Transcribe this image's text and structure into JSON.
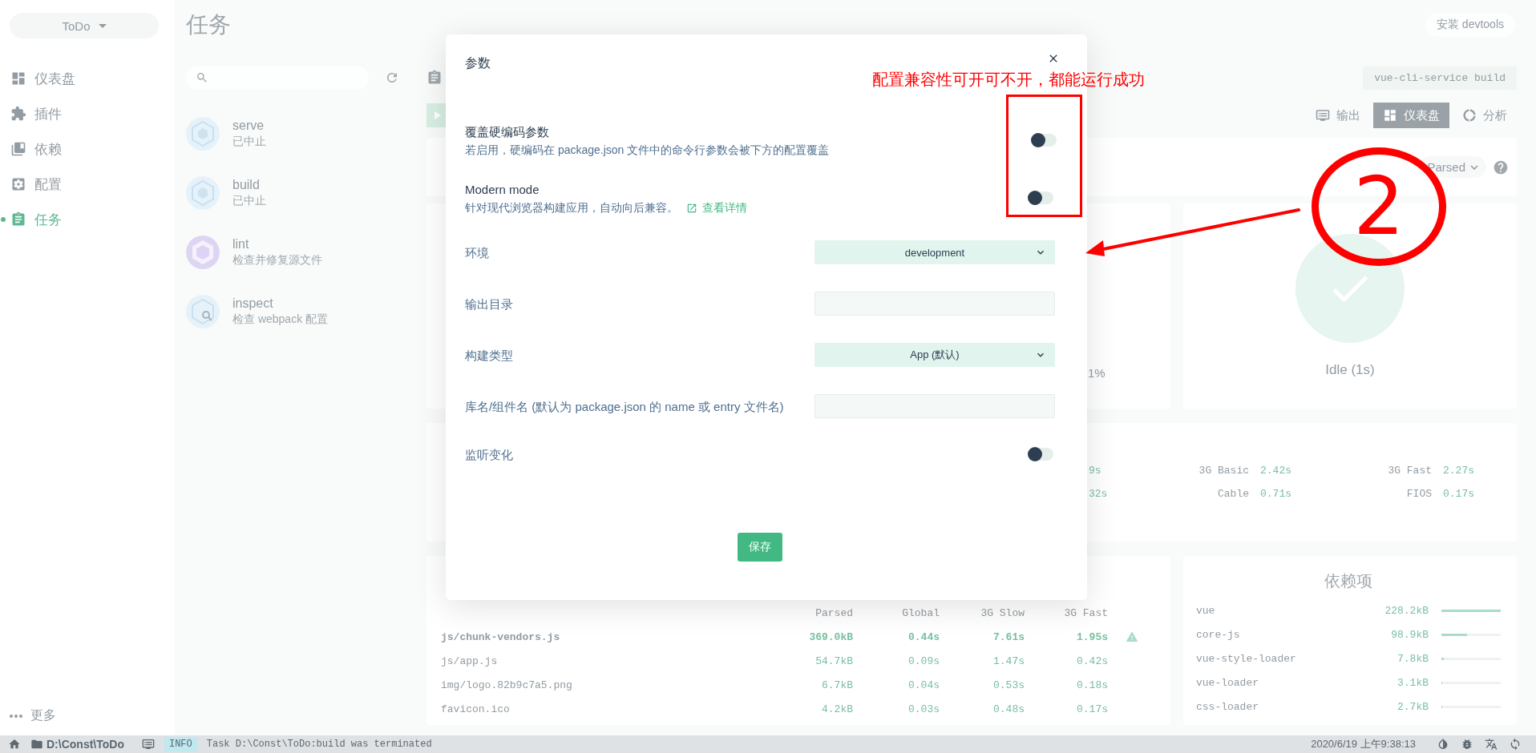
{
  "sidebar": {
    "project": "ToDo",
    "items": [
      {
        "label": "仪表盘",
        "selected": false
      },
      {
        "label": "插件",
        "selected": false
      },
      {
        "label": "依赖",
        "selected": false
      },
      {
        "label": "配置",
        "selected": false
      },
      {
        "label": "任务",
        "selected": true
      }
    ],
    "more": "更多"
  },
  "header": {
    "title": "任务",
    "devtools_button": "安装 devtools"
  },
  "tasks": [
    {
      "name": "serve",
      "status": "已中止",
      "kind": "webpack"
    },
    {
      "name": "build",
      "status": "已中止",
      "kind": "webpack"
    },
    {
      "name": "lint",
      "status": "检查并修复源文件",
      "kind": "eslint"
    },
    {
      "name": "inspect",
      "status": "检查 webpack 配置",
      "kind": "inspect"
    }
  ],
  "task_detail": {
    "command": "vue-cli-service build",
    "tabs": [
      {
        "label": "输出",
        "selected": false
      },
      {
        "label": "仪表盘",
        "selected": true
      },
      {
        "label": "分析",
        "selected": false
      }
    ],
    "size_select": "Parsed",
    "progress_reading": "1%",
    "status": "Idle (1s)",
    "speed": {
      "partial_values": [
        "9s",
        "32s"
      ],
      "groups": [
        {
          "rows": [
            {
              "label": "3G Basic",
              "value": "2.42s"
            },
            {
              "label": "Cable",
              "value": "0.71s"
            }
          ]
        },
        {
          "rows": [
            {
              "label": "3G Fast",
              "value": "2.27s"
            },
            {
              "label": "FIOS",
              "value": "0.17s"
            }
          ]
        }
      ]
    },
    "assets": {
      "columns": [
        "Parsed",
        "Global",
        "3G Slow",
        "3G Fast"
      ],
      "rows": [
        {
          "name": "js/chunk-vendors.js",
          "values": [
            "369.0kB",
            "0.44s",
            "7.61s",
            "1.95s"
          ],
          "warning": true
        },
        {
          "name": "js/app.js",
          "values": [
            "54.7kB",
            "0.09s",
            "1.47s",
            "0.42s"
          ],
          "warning": false
        },
        {
          "name": "img/logo.82b9c7a5.png",
          "values": [
            "6.7kB",
            "0.04s",
            "0.53s",
            "0.18s"
          ],
          "warning": false
        },
        {
          "name": "favicon.ico",
          "values": [
            "4.2kB",
            "0.03s",
            "0.48s",
            "0.17s"
          ],
          "warning": false
        }
      ]
    },
    "dependencies": {
      "title": "依赖项",
      "rows": [
        {
          "name": "vue",
          "size": "228.2kB",
          "level": 1
        },
        {
          "name": "core-js",
          "size": "98.9kB",
          "level": 0.43
        },
        {
          "name": "vue-style-loader",
          "size": "7.8kB",
          "level": 0.04
        },
        {
          "name": "vue-loader",
          "size": "3.1kB",
          "level": 0.015
        },
        {
          "name": "css-loader",
          "size": "2.7kB",
          "level": 0.013
        }
      ]
    }
  },
  "dialog": {
    "title": "参数",
    "fields": [
      {
        "kind": "toggle",
        "label": "覆盖硬编码参数",
        "description": "若启用，硬编码在 package.json 文件中的命令行参数会被下方的配置覆盖",
        "on": false
      },
      {
        "kind": "toggle",
        "label": "Modern mode",
        "description": "针对现代浏览器构建应用，自动向后兼容。",
        "link": "查看详情",
        "on": false
      },
      {
        "kind": "select",
        "label": "环境",
        "value": "development"
      },
      {
        "kind": "input",
        "label": "输出目录"
      },
      {
        "kind": "select",
        "label": "构建类型",
        "value": "App (默认)"
      },
      {
        "kind": "input",
        "label": "库名/组件名 (默认为 package.json 的 name 或 entry 文件名)"
      },
      {
        "kind": "toggle",
        "label": "监听变化",
        "on": false
      }
    ],
    "save_button": "保存"
  },
  "annotations": {
    "note": "配置兼容性可开可不开，都能运行成功",
    "step_number": "2"
  },
  "status_bar": {
    "path": "D:\\Const\\ToDo",
    "log_level": "INFO",
    "message": "Task D:\\Const\\ToDo:build was terminated",
    "datetime": "2020/6/19 上午9:38:13"
  }
}
